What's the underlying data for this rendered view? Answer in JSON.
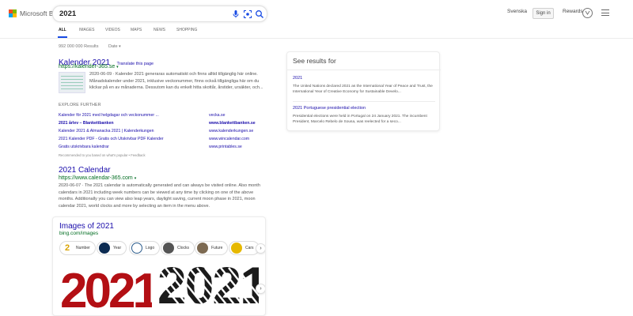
{
  "header": {
    "logo_text": "Microsoft Bing",
    "search_query": "2021",
    "language": "Svenska",
    "sign_in_label": "Sign in",
    "rewards_label": "Rewards"
  },
  "tabs": [
    "ALL",
    "IMAGES",
    "VIDEOS",
    "MAPS",
    "NEWS",
    "SHOPPING"
  ],
  "meta": {
    "results_count": "992 000 000 Results",
    "date_filter": "Date"
  },
  "results": [
    {
      "title": "Kalender 2021",
      "translate": "Translate this page",
      "url": "https://kalender-365.se",
      "date": "2020-06-09",
      "snippet_lines": [
        "Kalender 2021 generaras automatiskt och finns alltid tillgänglig här online.",
        "Månadskalender under 2021, inklusive veckonummer, finns också tillgängliga här om du",
        "klickar på en av månaderna. Dessutom kan du enkelt hitta skottår, årstider, ursäkter, och..."
      ]
    },
    {
      "title": "2021 Calendar",
      "url": "https://www.calendar-365.com",
      "date": "2020-06-07",
      "snippet_lines": [
        "2020-06-07 · The 2021 calendar is automatically generated and can always be visited online. Also month",
        "calendars in 2021 including week numbers can be viewed at any time by clicking on one of the above",
        "months. Additionally you can view also leap years, daylight saving, current moon phase in 2021, moon",
        "calendar 2021, world clocks and more by selecting an item in the menu above."
      ]
    }
  ],
  "explore": {
    "header": "EXPLORE FURTHER",
    "items": [
      {
        "text": "Kalender för 2021 med helgdagar och veckonummer ...",
        "site": "vecka.se"
      },
      {
        "text": "2021 årlev – Blankettbanken",
        "site": "www.blankettbanken.se"
      },
      {
        "text": "Kalender 2021 & Almanacka 2021 | Kalenderkungen",
        "site": "www.kalenderkungen.se"
      },
      {
        "text": "2021 Kalender PDF - Gratis och Utskrivbar PDF Kalender",
        "site": "www.wincalendar.com"
      },
      {
        "text": "Gratis utskrivbara kalendrar",
        "site": "www.printables.se"
      }
    ],
    "note": "Recommended to you based on what's popular • Feedback"
  },
  "see_results": {
    "heading": "See results for",
    "items": [
      {
        "title": "2021",
        "desc": "The United Nations declared 2021 as the International Year of Peace and Trust, the International Year of Creative Economy for Sustainable Develo..."
      },
      {
        "title": "2021 Portuguese presidential election",
        "desc": "Presidential elections were held in Portugal on 24 January 2021. The incumbent President, Marcelo Rebelo de Sousa, was reelected for a seco..."
      }
    ]
  },
  "images": {
    "title": "Images of 2021",
    "source": "bing.com/images",
    "chips": [
      "Number",
      "Year",
      "Logo",
      "Clocks",
      "Future",
      "Cars"
    ],
    "chip_colors": [
      "#d9a300",
      "#0c2b52",
      "#2a5b8c",
      "#555555",
      "#7d6a52",
      "#e6b800"
    ],
    "big_number": "2021",
    "big_number_color": "#b30f14"
  }
}
